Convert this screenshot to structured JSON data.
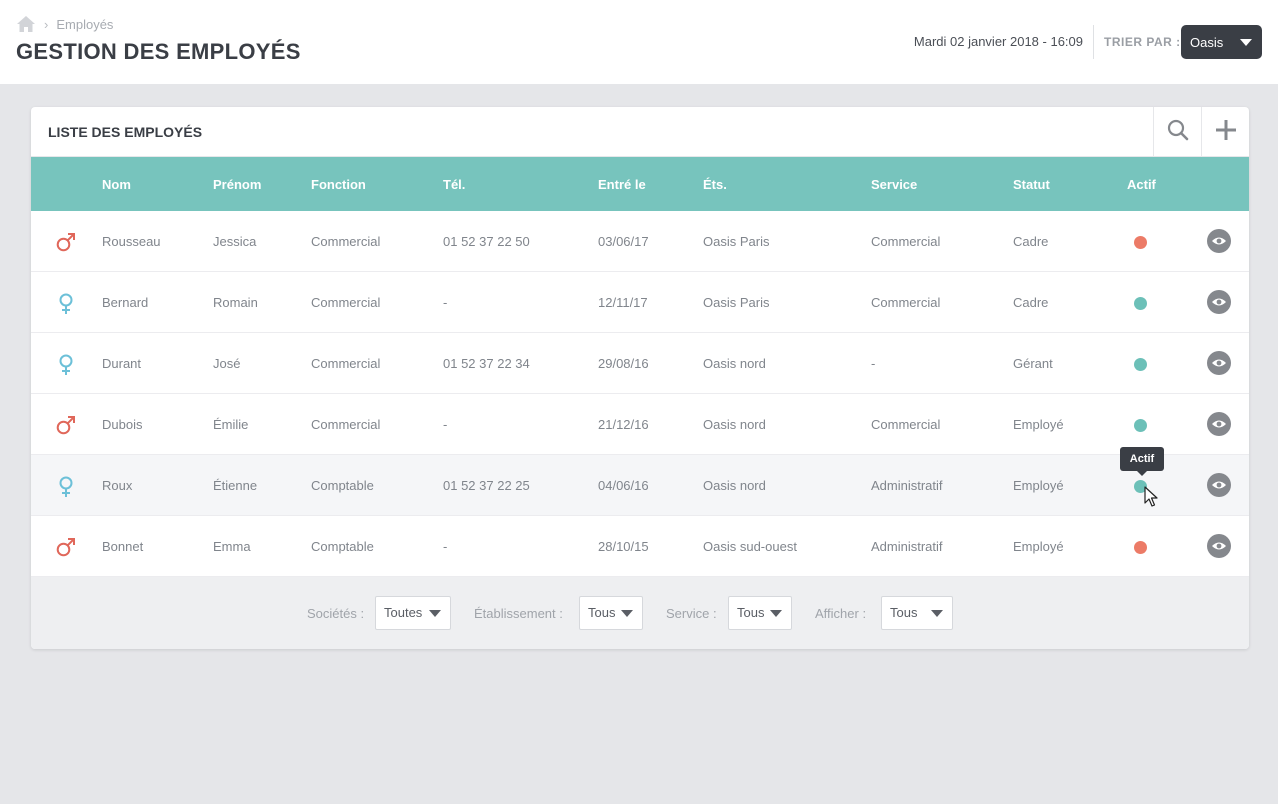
{
  "header": {
    "breadcrumb": "Employés",
    "title": "GESTION DES EMPLOYÉS",
    "datetime": "Mardi 02 janvier 2018 - 16:09",
    "sort_label": "TRIER PAR :",
    "sort_value": "Oasis"
  },
  "panel": {
    "title": "LISTE DES EMPLOYÉS",
    "columns": [
      "Nom",
      "Prénom",
      "Fonction",
      "Tél.",
      "Entré le",
      "Éts.",
      "Service",
      "Statut",
      "Actif"
    ],
    "rows": [
      {
        "gender": "male",
        "nom": "Rousseau",
        "prenom": "Jessica",
        "fonction": "Commercial",
        "tel": "01 52 37 22 50",
        "entre": "03/06/17",
        "ets": "Oasis Paris",
        "service": "Commercial",
        "statut": "Cadre",
        "actif": false
      },
      {
        "gender": "female",
        "nom": "Bernard",
        "prenom": "Romain",
        "fonction": "Commercial",
        "tel": "-",
        "entre": "12/11/17",
        "ets": "Oasis Paris",
        "service": "Commercial",
        "statut": "Cadre",
        "actif": true
      },
      {
        "gender": "female",
        "nom": "Durant",
        "prenom": "José",
        "fonction": "Commercial",
        "tel": "01 52 37 22 34",
        "entre": "29/08/16",
        "ets": "Oasis nord",
        "service": "-",
        "statut": "Gérant",
        "actif": true
      },
      {
        "gender": "male",
        "nom": "Dubois",
        "prenom": "Émilie",
        "fonction": "Commercial",
        "tel": "-",
        "entre": "21/12/16",
        "ets": "Oasis nord",
        "service": "Commercial",
        "statut": "Employé",
        "actif": true
      },
      {
        "gender": "female",
        "nom": "Roux",
        "prenom": "Étienne",
        "fonction": "Comptable",
        "tel": "01 52 37 22 25",
        "entre": "04/06/16",
        "ets": "Oasis nord",
        "service": "Administratif",
        "statut": "Employé",
        "actif": true
      },
      {
        "gender": "male",
        "nom": "Bonnet",
        "prenom": "Emma",
        "fonction": "Comptable",
        "tel": "-",
        "entre": "28/10/15",
        "ets": "Oasis sud-ouest",
        "service": "Administratif",
        "statut": "Employé",
        "actif": false
      }
    ],
    "tooltip": "Actif"
  },
  "filters": [
    {
      "label": "Sociétés :",
      "value": "Toutes"
    },
    {
      "label": "Établissement :",
      "value": "Tous"
    },
    {
      "label": "Service :",
      "value": "Tous"
    },
    {
      "label": "Afficher :",
      "value": "Tous"
    }
  ],
  "colors": {
    "teal": "#77c4bd",
    "active_dot": "#6cc0b8",
    "inactive_dot": "#ec7b67",
    "male_icon": "#e0675a",
    "female_icon": "#6cc0d8",
    "dark": "#3a3e45"
  },
  "icons": {
    "home": "home-icon",
    "search": "search-icon",
    "add": "plus-icon",
    "view": "eye-icon",
    "male": "male-symbol-icon",
    "female": "female-symbol-icon"
  }
}
